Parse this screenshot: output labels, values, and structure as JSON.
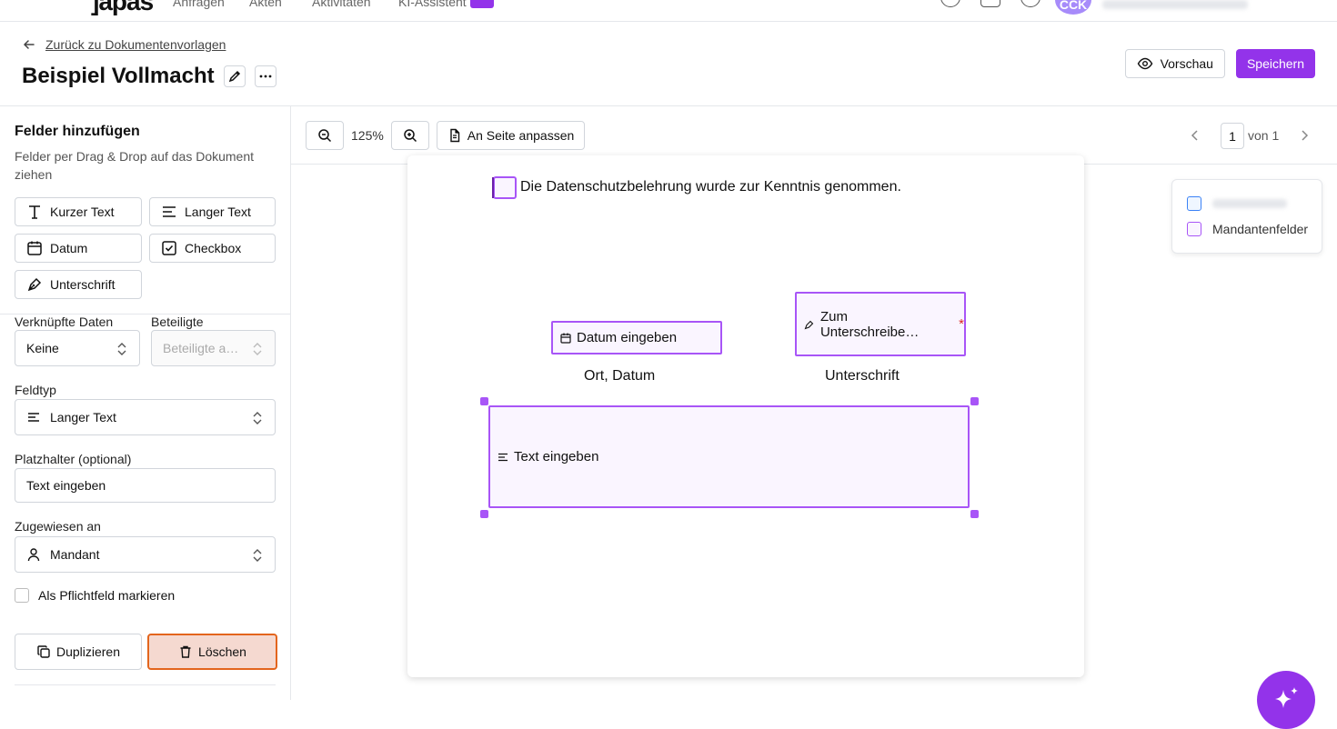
{
  "topnav": {
    "logo": "]apas",
    "items": [
      "Anfragen",
      "Akten",
      "Aktivitäten",
      "KI-Assistent"
    ],
    "avatar_initials": "CCK"
  },
  "header": {
    "back_label": "Zurück zu Dokumentenvorlagen",
    "title": "Beispiel Vollmacht",
    "preview_label": "Vorschau",
    "save_label": "Speichern"
  },
  "sidebar": {
    "title": "Felder hinzufügen",
    "description": "Felder per Drag & Drop auf das Dokument ziehen",
    "field_types": [
      "Kurzer Text",
      "Langer Text",
      "Datum",
      "Checkbox",
      "Unterschrift"
    ],
    "linked_data_label": "Verknüpfte Daten",
    "linked_data_value": "Keine",
    "participants_label": "Beteiligte",
    "participants_placeholder": "Beteiligte a…",
    "fieldtype_label": "Feldtyp",
    "fieldtype_value": "Langer Text",
    "placeholder_label": "Platzhalter (optional)",
    "placeholder_value": "Text eingeben",
    "assigned_label": "Zugewiesen an",
    "assigned_value": "Mandant",
    "required_label": "Als Pflichtfeld markieren",
    "duplicate_label": "Duplizieren",
    "delete_label": "Löschen"
  },
  "toolbar": {
    "zoom": "125%",
    "fit_label": "An Seite anpassen",
    "page_current": "1",
    "page_of": "von 1"
  },
  "document": {
    "checkbox_text": "Die Datenschutzbelehrung wurde zur Kenntnis genommen.",
    "date_field": "Datum eingeben",
    "date_caption": "Ort, Datum",
    "signature_field": "Zum Unterschreibe…",
    "signature_required": "*",
    "signature_caption": "Unterschrift",
    "text_field": "Text eingeben"
  },
  "legend": {
    "items": [
      {
        "label": "",
        "color": "#3b82f6"
      },
      {
        "label": "Mandantenfelder",
        "color": "#a855f7"
      }
    ]
  },
  "colors": {
    "accent": "#9333ea",
    "field_border": "#a855f7",
    "danger_border": "#e3651d"
  }
}
